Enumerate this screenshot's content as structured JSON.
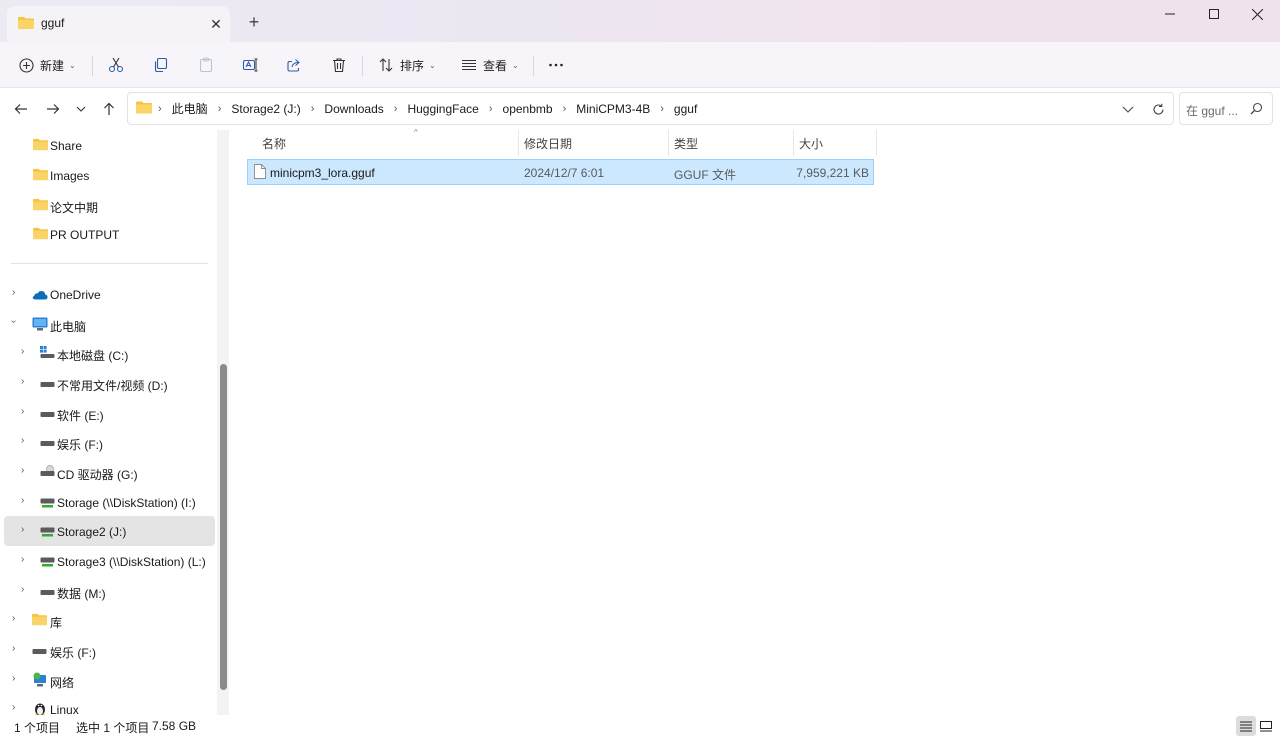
{
  "tab": {
    "title": "gguf"
  },
  "toolbar": {
    "new_label": "新建",
    "sort_label": "排序",
    "view_label": "查看"
  },
  "breadcrumb": [
    "此电脑",
    "Storage2 (J:)",
    "Downloads",
    "HuggingFace",
    "openbmb",
    "MiniCPM3-4B",
    "gguf"
  ],
  "search": {
    "placeholder": "在 gguf ..."
  },
  "sidebar": {
    "quick": [
      "Share",
      "Images",
      "论文中期",
      "PR OUTPUT"
    ],
    "tree": [
      {
        "label": "OneDrive",
        "icon": "cloud-icon"
      },
      {
        "label": "此电脑",
        "icon": "computer-icon"
      },
      {
        "label": "本地磁盘 (C:)",
        "icon": "windows-drive-icon"
      },
      {
        "label": "不常用文件/视频 (D:)",
        "icon": "drive-icon"
      },
      {
        "label": "软件 (E:)",
        "icon": "drive-icon"
      },
      {
        "label": "娱乐 (F:)",
        "icon": "drive-icon"
      },
      {
        "label": "CD 驱动器 (G:)",
        "icon": "cd-drive-icon"
      },
      {
        "label": "Storage (\\\\DiskStation) (I:)",
        "icon": "network-drive-icon"
      },
      {
        "label": "Storage2 (J:)",
        "icon": "network-drive-icon"
      },
      {
        "label": "Storage3 (\\\\DiskStation) (L:)",
        "icon": "network-drive-icon"
      },
      {
        "label": "数据 (M:)",
        "icon": "drive-icon"
      },
      {
        "label": "库",
        "icon": "library-icon"
      },
      {
        "label": "娱乐 (F:)",
        "icon": "drive-icon"
      },
      {
        "label": "网络",
        "icon": "network-icon"
      },
      {
        "label": "Linux",
        "icon": "linux-icon"
      }
    ]
  },
  "columns": {
    "name": "名称",
    "modified": "修改日期",
    "type": "类型",
    "size": "大小"
  },
  "files": [
    {
      "name": "minicpm3_lora.gguf",
      "modified": "2024/12/7 6:01",
      "type": "GGUF 文件",
      "size": "7,959,221 KB"
    }
  ],
  "status": {
    "count": "1 个项目",
    "selected": "选中 1 个项目",
    "selected_size": "7.58 GB"
  },
  "colors": {
    "accent": "#0067c0",
    "selection": "#cce8ff",
    "folder": "#f5c542"
  }
}
